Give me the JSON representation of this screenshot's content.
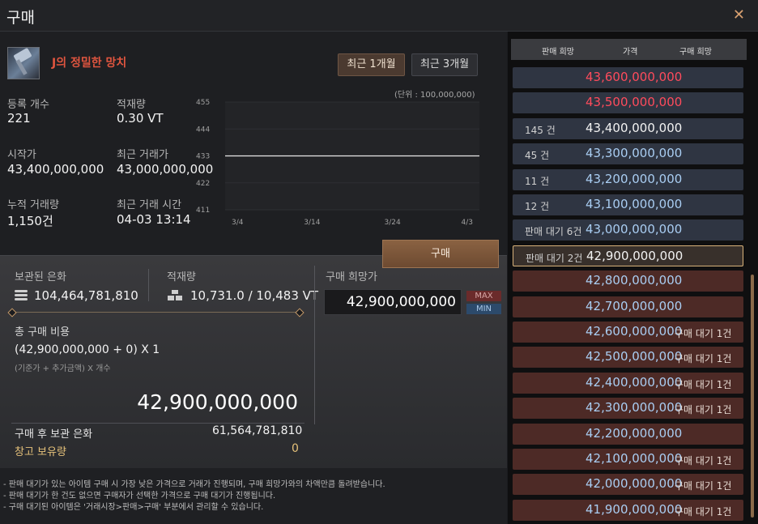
{
  "window": {
    "title": "구매",
    "close_label": "✕"
  },
  "item": {
    "name": "J의 정밀한 망치"
  },
  "periods": {
    "recent_1m": "최근 1개월",
    "recent_3m": "최근 3개월"
  },
  "stats": {
    "registered_label": "등록 개수",
    "registered_value": "221",
    "weight_label": "적재량",
    "weight_value": "0.30 VT",
    "start_label": "시작가",
    "start_value": "43,400,000,000",
    "last_trade_label": "최근 거래가",
    "last_trade_value": "43,000,000,000",
    "cumulative_label": "누적 거래량",
    "cumulative_value": "1,150건",
    "last_time_label": "최근 거래 시간",
    "last_time_value": "04-03 13:14"
  },
  "chart_data": {
    "type": "line",
    "unit_label": "(단위 : 100,000,000)",
    "y_ticks": [
      "455",
      "444",
      "433",
      "422",
      "411"
    ],
    "ylim": [
      411,
      455
    ],
    "x_ticks": [
      "3/4",
      "3/14",
      "3/24",
      "4/3"
    ],
    "series": [
      {
        "x": [
          "3/4",
          "4/3"
        ],
        "values": [
          433,
          433
        ]
      }
    ],
    "grid": true
  },
  "buy": {
    "silver_label": "보관된 은화",
    "silver_value": "104,464,781,810",
    "weight_label": "적재량",
    "weight_value": "10,731.0 / 10,483 VT",
    "desired_label": "구매 희망가",
    "desired_value": "42,900,000,000",
    "max_label": "MAX",
    "min_label": "MIN",
    "total_label": "총 구매 비용",
    "formula": "(42,900,000,000 + 0) X 1",
    "formula_hint": "(기준가 + 추가금액) X 개수",
    "total_value": "42,900,000,000",
    "after_label": "구매 후 보관 은화",
    "after_value": "61,564,781,810",
    "storage_label": "창고 보유량",
    "storage_value": "0",
    "buy_button": "구매"
  },
  "notes": [
    "- 판매 대기가 있는 아이템 구매 시 가장 낮은 가격으로 거래가 진행되며, 구매 희망가와의 차액만큼 돌려받습니다.",
    "- 판매 대기가 한 건도 없으면 구매자가 선택한 가격으로 구매 대기가 진행됩니다.",
    "- 구매 대기된 아이템은 '거래시장>판매>구매' 부분에서 관리할 수 있습니다."
  ],
  "orderbook": {
    "header": {
      "sell": "판매 희망",
      "price": "가격",
      "buy": "구매 희망"
    },
    "rows": [
      {
        "count": "",
        "price": "43,600,000,000",
        "buy": "",
        "type": "sell",
        "price_color": "#ff4b5c"
      },
      {
        "count": "",
        "price": "43,500,000,000",
        "buy": "",
        "type": "sell",
        "price_color": "#ff4b5c"
      },
      {
        "count": "145 건",
        "price": "43,400,000,000",
        "buy": "",
        "type": "sell",
        "price_color": "#f2f2f2"
      },
      {
        "count": "45 건",
        "price": "43,300,000,000",
        "buy": "",
        "type": "sell",
        "price_color": "#a9cdf2"
      },
      {
        "count": "11 건",
        "price": "43,200,000,000",
        "buy": "",
        "type": "sell",
        "price_color": "#a9cdf2"
      },
      {
        "count": "12 건",
        "price": "43,100,000,000",
        "buy": "",
        "type": "sell",
        "price_color": "#a9cdf2"
      },
      {
        "count": "판매 대기 6건",
        "price": "43,000,000,000",
        "buy": "",
        "type": "sell",
        "price_color": "#a9cdf2"
      },
      {
        "count": "판매 대기 2건",
        "price": "42,900,000,000",
        "buy": "",
        "type": "selected",
        "price_color": "#f2f2f2"
      },
      {
        "count": "",
        "price": "42,800,000,000",
        "buy": "",
        "type": "buy",
        "price_color": "#a9cdf2"
      },
      {
        "count": "",
        "price": "42,700,000,000",
        "buy": "",
        "type": "buy",
        "price_color": "#a9cdf2"
      },
      {
        "count": "",
        "price": "42,600,000,000",
        "buy": "구매 대기 1건",
        "type": "buy",
        "price_color": "#a9cdf2"
      },
      {
        "count": "",
        "price": "42,500,000,000",
        "buy": "구매 대기 1건",
        "type": "buy",
        "price_color": "#a9cdf2"
      },
      {
        "count": "",
        "price": "42,400,000,000",
        "buy": "구매 대기 1건",
        "type": "buy",
        "price_color": "#a9cdf2"
      },
      {
        "count": "",
        "price": "42,300,000,000",
        "buy": "구매 대기 1건",
        "type": "buy",
        "price_color": "#a9cdf2"
      },
      {
        "count": "",
        "price": "42,200,000,000",
        "buy": "",
        "type": "buy",
        "price_color": "#a9cdf2"
      },
      {
        "count": "",
        "price": "42,100,000,000",
        "buy": "구매 대기 1건",
        "type": "buy",
        "price_color": "#a9cdf2"
      },
      {
        "count": "",
        "price": "42,000,000,000",
        "buy": "구매 대기 1건",
        "type": "buy",
        "price_color": "#a9cdf2"
      },
      {
        "count": "",
        "price": "41,900,000,000",
        "buy": "구매 대기 1건",
        "type": "buy",
        "price_color": "#a9cdf2"
      }
    ]
  }
}
